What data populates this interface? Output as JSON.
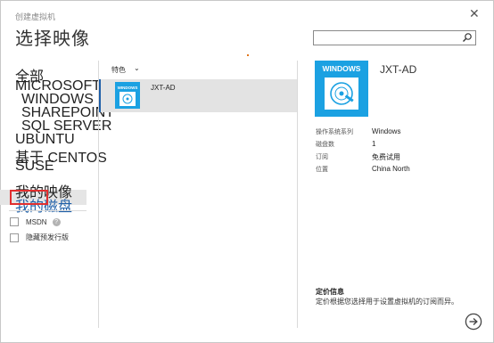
{
  "wizard": {
    "title": "创建虚拟机",
    "page_title": "选择映像",
    "close": "✕"
  },
  "search": {
    "placeholder": "",
    "icon": "search-icon"
  },
  "nav": {
    "items": [
      {
        "label": "全部"
      },
      {
        "label": "MICROSOFT"
      },
      {
        "label": "WINDOWS SERVER"
      },
      {
        "label": "SHAREPOINT"
      },
      {
        "label": "SQL SERVER"
      },
      {
        "label": "UBUNTU"
      },
      {
        "label": "基于 CENTOS"
      },
      {
        "label": "SUSE"
      },
      {
        "label": "我的映像"
      },
      {
        "label": "我的磁盘"
      }
    ],
    "selected": "我的磁盘"
  },
  "filters": [
    {
      "label": "MSDN",
      "checked": false
    },
    {
      "label": "隐藏预发行版",
      "checked": false
    }
  ],
  "list": {
    "sort_label": "特色",
    "sort_chevron": "⌄",
    "items": [
      {
        "name": "JXT-AD",
        "tile_text": "WINDOWS"
      }
    ]
  },
  "detail": {
    "tile_text": "WINDOWS",
    "title": "JXT-AD",
    "props": [
      {
        "label": "操作系统系列",
        "value": "Windows"
      },
      {
        "label": "磁盘数",
        "value": "1"
      },
      {
        "label": "订阅",
        "value": "免费试用"
      },
      {
        "label": "位置",
        "value": "China North"
      }
    ],
    "pricing_title": "定价信息",
    "pricing_desc": "定价根据您选择用于设置虚拟机的订阅而异。"
  },
  "colors": {
    "accent_blue": "#1ba1e2",
    "selection_bar": "#1e5fa8",
    "highlight_red": "#e12f2f"
  }
}
